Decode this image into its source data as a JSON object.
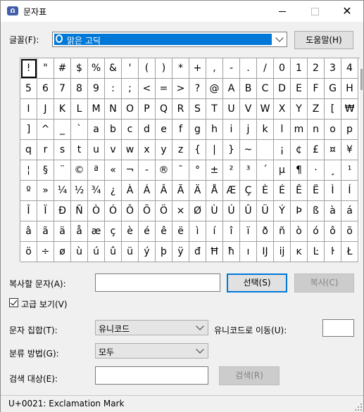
{
  "window": {
    "title": "문자표",
    "icon": "character-map-icon",
    "minimize": "minimize-icon",
    "maximize": "maximize-icon",
    "close": "✕"
  },
  "font_row": {
    "label": "글꼴(F):",
    "font_name": "맑은 고딕",
    "help_button": "도움말(H)"
  },
  "grid": {
    "selected_index": 0,
    "chars": [
      "!",
      "\"",
      "#",
      "$",
      "%",
      "&",
      "'",
      "(",
      ")",
      "*",
      "+",
      ",",
      "-",
      ".",
      "/",
      "0",
      "1",
      "2",
      "3",
      "4",
      "5",
      "6",
      "7",
      "8",
      "9",
      ":",
      ";",
      "<",
      "=",
      ">",
      "?",
      "@",
      "A",
      "B",
      "C",
      "D",
      "E",
      "F",
      "G",
      "H",
      "I",
      "J",
      "K",
      "L",
      "M",
      "N",
      "O",
      "P",
      "Q",
      "R",
      "S",
      "T",
      "U",
      "V",
      "W",
      "X",
      "Y",
      "Z",
      "[",
      "₩",
      "]",
      "^",
      "_",
      "`",
      "a",
      "b",
      "c",
      "d",
      "e",
      "f",
      "g",
      "h",
      "i",
      "j",
      "k",
      "l",
      "m",
      "n",
      "o",
      "p",
      "q",
      "r",
      "s",
      "t",
      "u",
      "v",
      "w",
      "x",
      "y",
      "z",
      "{",
      "|",
      "}",
      "~",
      " ",
      "¡",
      "¢",
      "£",
      "¤",
      "¥",
      "¦",
      "§",
      "¨",
      "©",
      "ª",
      "«",
      "¬",
      "-",
      "®",
      "¯",
      "°",
      "±",
      "²",
      "³",
      "´",
      "µ",
      "¶",
      "·",
      "¸",
      "¹",
      "º",
      "»",
      "¼",
      "½",
      "¾",
      "¿",
      "À",
      "Á",
      "Â",
      "Ã",
      "Ä",
      "Å",
      "Æ",
      "Ç",
      "È",
      "É",
      "Ê",
      "Ë",
      "Ì",
      "Í",
      "Î",
      "Ï",
      "Ð",
      "Ñ",
      "Ò",
      "Ó",
      "Ô",
      "Õ",
      "Ö",
      "×",
      "Ø",
      "Ù",
      "Ú",
      "Û",
      "Ü",
      "Ý",
      "Þ",
      "ß",
      "à",
      "á",
      "â",
      "ã",
      "ä",
      "å",
      "æ",
      "ç",
      "è",
      "é",
      "ê",
      "ë",
      "ì",
      "í",
      "î",
      "ï",
      "ð",
      "ñ",
      "ò",
      "ó",
      "ô",
      "õ",
      "ö",
      "÷",
      "ø",
      "ù",
      "ú",
      "û",
      "ü",
      "ý",
      "þ",
      "ÿ",
      "đ",
      "Ħ",
      "ħ",
      "ı",
      "Ĳ",
      "ĳ",
      "ĸ",
      "Ŀ",
      "ŀ",
      "Ł"
    ]
  },
  "copy_row": {
    "label": "복사할 문자(A):",
    "value": "",
    "select_button": "선택(S)",
    "copy_button": "복사(C)"
  },
  "advanced": {
    "label": "고급 보기(V)",
    "checked": true
  },
  "charset_row": {
    "label": "문자 집합(T):",
    "value": "유니코드",
    "goto_label": "유니코드로 이동(U):",
    "goto_value": ""
  },
  "group_row": {
    "label": "분류 방법(G):",
    "value": "모두"
  },
  "search_row": {
    "label": "검색 대상(E):",
    "value": "",
    "search_button": "검색(R)"
  },
  "status": {
    "text": "U+0021: Exclamation Mark"
  }
}
